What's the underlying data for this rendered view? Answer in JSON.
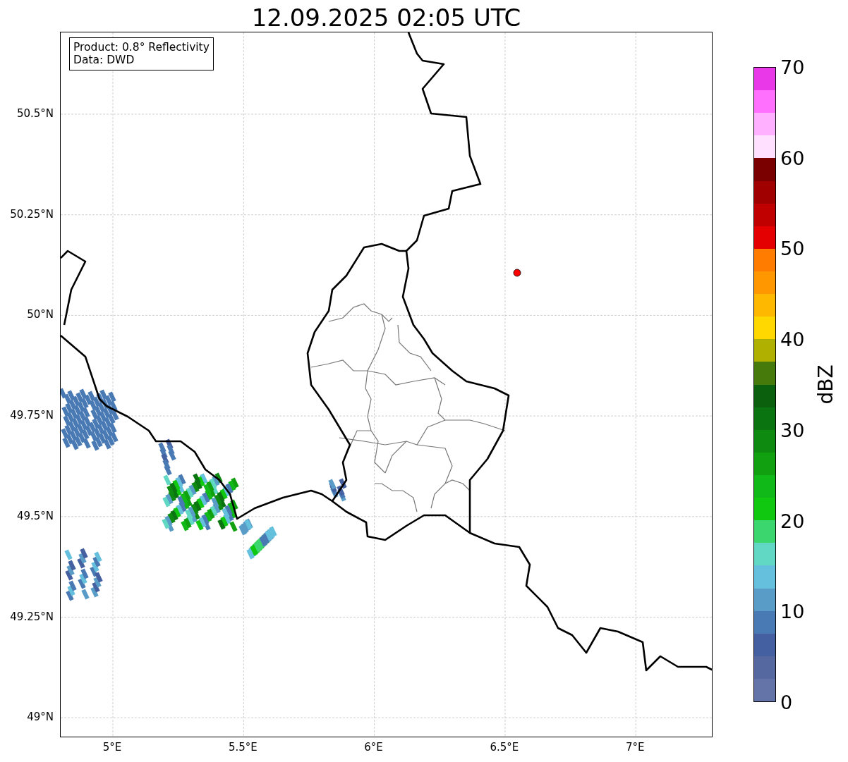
{
  "title": "12.09.2025 02:05 UTC",
  "info_box": {
    "lines": [
      "Product: 0.8° Reflectivity",
      "Data: DWD"
    ]
  },
  "map": {
    "lat_ticks": [
      "50.5°N",
      "50.25°N",
      "50°N",
      "49.75°N",
      "49.5°N",
      "49.25°N",
      "49°N"
    ],
    "lon_ticks": [
      "5°E",
      "5.5°E",
      "6°E",
      "6.5°E",
      "7°E"
    ]
  },
  "colorbar": {
    "label": "dBZ",
    "ticks": [
      "70",
      "60",
      "50",
      "40",
      "30",
      "20",
      "10",
      "0"
    ],
    "segments": [
      {
        "color": "#e838e8"
      },
      {
        "color": "#ff70ff"
      },
      {
        "color": "#ffb0ff"
      },
      {
        "color": "#ffe0ff"
      },
      {
        "color": "#7a0000"
      },
      {
        "color": "#a00000"
      },
      {
        "color": "#c00000"
      },
      {
        "color": "#e40000"
      },
      {
        "color": "#ff7c00"
      },
      {
        "color": "#ff9800"
      },
      {
        "color": "#ffb800"
      },
      {
        "color": "#ffd800"
      },
      {
        "color": "#b0b000"
      },
      {
        "color": "#467a0a"
      },
      {
        "color": "#0a600c"
      },
      {
        "color": "#0a7410"
      },
      {
        "color": "#0e8a10"
      },
      {
        "color": "#10a010"
      },
      {
        "color": "#10b818"
      },
      {
        "color": "#10c810"
      },
      {
        "color": "#3cd66e"
      },
      {
        "color": "#60d8c4"
      },
      {
        "color": "#64c0dc"
      },
      {
        "color": "#5a9cc8"
      },
      {
        "color": "#4a7ab4"
      },
      {
        "color": "#4560a0"
      },
      {
        "color": "#5568a0"
      },
      {
        "color": "#6474a8"
      }
    ]
  }
}
